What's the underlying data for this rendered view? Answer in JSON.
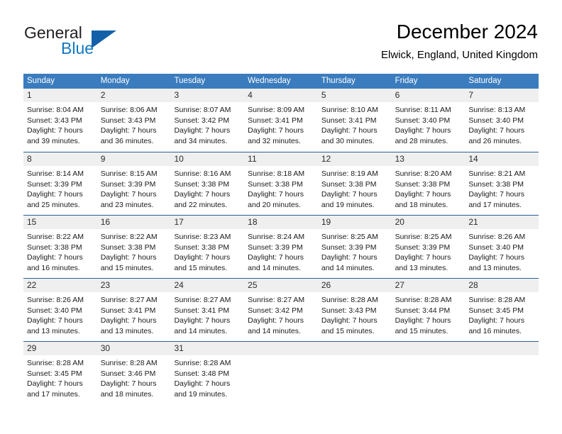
{
  "brand": {
    "name_part1": "General",
    "name_part2": "Blue",
    "triangle_icon": "triangle-icon",
    "accent_color": "#1460a8",
    "blue_text_color": "#1277c0"
  },
  "header": {
    "month_title": "December 2024",
    "location": "Elwick, England, United Kingdom"
  },
  "calendar": {
    "header_bg": "#3a7cbe",
    "daynum_bg": "#efefef",
    "row_divider": "#2a6099",
    "weekdays": [
      "Sunday",
      "Monday",
      "Tuesday",
      "Wednesday",
      "Thursday",
      "Friday",
      "Saturday"
    ],
    "weeks": [
      [
        {
          "day": "1",
          "sunrise": "Sunrise: 8:04 AM",
          "sunset": "Sunset: 3:43 PM",
          "daylight1": "Daylight: 7 hours",
          "daylight2": "and 39 minutes."
        },
        {
          "day": "2",
          "sunrise": "Sunrise: 8:06 AM",
          "sunset": "Sunset: 3:43 PM",
          "daylight1": "Daylight: 7 hours",
          "daylight2": "and 36 minutes."
        },
        {
          "day": "3",
          "sunrise": "Sunrise: 8:07 AM",
          "sunset": "Sunset: 3:42 PM",
          "daylight1": "Daylight: 7 hours",
          "daylight2": "and 34 minutes."
        },
        {
          "day": "4",
          "sunrise": "Sunrise: 8:09 AM",
          "sunset": "Sunset: 3:41 PM",
          "daylight1": "Daylight: 7 hours",
          "daylight2": "and 32 minutes."
        },
        {
          "day": "5",
          "sunrise": "Sunrise: 8:10 AM",
          "sunset": "Sunset: 3:41 PM",
          "daylight1": "Daylight: 7 hours",
          "daylight2": "and 30 minutes."
        },
        {
          "day": "6",
          "sunrise": "Sunrise: 8:11 AM",
          "sunset": "Sunset: 3:40 PM",
          "daylight1": "Daylight: 7 hours",
          "daylight2": "and 28 minutes."
        },
        {
          "day": "7",
          "sunrise": "Sunrise: 8:13 AM",
          "sunset": "Sunset: 3:40 PM",
          "daylight1": "Daylight: 7 hours",
          "daylight2": "and 26 minutes."
        }
      ],
      [
        {
          "day": "8",
          "sunrise": "Sunrise: 8:14 AM",
          "sunset": "Sunset: 3:39 PM",
          "daylight1": "Daylight: 7 hours",
          "daylight2": "and 25 minutes."
        },
        {
          "day": "9",
          "sunrise": "Sunrise: 8:15 AM",
          "sunset": "Sunset: 3:39 PM",
          "daylight1": "Daylight: 7 hours",
          "daylight2": "and 23 minutes."
        },
        {
          "day": "10",
          "sunrise": "Sunrise: 8:16 AM",
          "sunset": "Sunset: 3:38 PM",
          "daylight1": "Daylight: 7 hours",
          "daylight2": "and 22 minutes."
        },
        {
          "day": "11",
          "sunrise": "Sunrise: 8:18 AM",
          "sunset": "Sunset: 3:38 PM",
          "daylight1": "Daylight: 7 hours",
          "daylight2": "and 20 minutes."
        },
        {
          "day": "12",
          "sunrise": "Sunrise: 8:19 AM",
          "sunset": "Sunset: 3:38 PM",
          "daylight1": "Daylight: 7 hours",
          "daylight2": "and 19 minutes."
        },
        {
          "day": "13",
          "sunrise": "Sunrise: 8:20 AM",
          "sunset": "Sunset: 3:38 PM",
          "daylight1": "Daylight: 7 hours",
          "daylight2": "and 18 minutes."
        },
        {
          "day": "14",
          "sunrise": "Sunrise: 8:21 AM",
          "sunset": "Sunset: 3:38 PM",
          "daylight1": "Daylight: 7 hours",
          "daylight2": "and 17 minutes."
        }
      ],
      [
        {
          "day": "15",
          "sunrise": "Sunrise: 8:22 AM",
          "sunset": "Sunset: 3:38 PM",
          "daylight1": "Daylight: 7 hours",
          "daylight2": "and 16 minutes."
        },
        {
          "day": "16",
          "sunrise": "Sunrise: 8:22 AM",
          "sunset": "Sunset: 3:38 PM",
          "daylight1": "Daylight: 7 hours",
          "daylight2": "and 15 minutes."
        },
        {
          "day": "17",
          "sunrise": "Sunrise: 8:23 AM",
          "sunset": "Sunset: 3:38 PM",
          "daylight1": "Daylight: 7 hours",
          "daylight2": "and 15 minutes."
        },
        {
          "day": "18",
          "sunrise": "Sunrise: 8:24 AM",
          "sunset": "Sunset: 3:39 PM",
          "daylight1": "Daylight: 7 hours",
          "daylight2": "and 14 minutes."
        },
        {
          "day": "19",
          "sunrise": "Sunrise: 8:25 AM",
          "sunset": "Sunset: 3:39 PM",
          "daylight1": "Daylight: 7 hours",
          "daylight2": "and 14 minutes."
        },
        {
          "day": "20",
          "sunrise": "Sunrise: 8:25 AM",
          "sunset": "Sunset: 3:39 PM",
          "daylight1": "Daylight: 7 hours",
          "daylight2": "and 13 minutes."
        },
        {
          "day": "21",
          "sunrise": "Sunrise: 8:26 AM",
          "sunset": "Sunset: 3:40 PM",
          "daylight1": "Daylight: 7 hours",
          "daylight2": "and 13 minutes."
        }
      ],
      [
        {
          "day": "22",
          "sunrise": "Sunrise: 8:26 AM",
          "sunset": "Sunset: 3:40 PM",
          "daylight1": "Daylight: 7 hours",
          "daylight2": "and 13 minutes."
        },
        {
          "day": "23",
          "sunrise": "Sunrise: 8:27 AM",
          "sunset": "Sunset: 3:41 PM",
          "daylight1": "Daylight: 7 hours",
          "daylight2": "and 13 minutes."
        },
        {
          "day": "24",
          "sunrise": "Sunrise: 8:27 AM",
          "sunset": "Sunset: 3:41 PM",
          "daylight1": "Daylight: 7 hours",
          "daylight2": "and 14 minutes."
        },
        {
          "day": "25",
          "sunrise": "Sunrise: 8:27 AM",
          "sunset": "Sunset: 3:42 PM",
          "daylight1": "Daylight: 7 hours",
          "daylight2": "and 14 minutes."
        },
        {
          "day": "26",
          "sunrise": "Sunrise: 8:28 AM",
          "sunset": "Sunset: 3:43 PM",
          "daylight1": "Daylight: 7 hours",
          "daylight2": "and 15 minutes."
        },
        {
          "day": "27",
          "sunrise": "Sunrise: 8:28 AM",
          "sunset": "Sunset: 3:44 PM",
          "daylight1": "Daylight: 7 hours",
          "daylight2": "and 15 minutes."
        },
        {
          "day": "28",
          "sunrise": "Sunrise: 8:28 AM",
          "sunset": "Sunset: 3:45 PM",
          "daylight1": "Daylight: 7 hours",
          "daylight2": "and 16 minutes."
        }
      ],
      [
        {
          "day": "29",
          "sunrise": "Sunrise: 8:28 AM",
          "sunset": "Sunset: 3:45 PM",
          "daylight1": "Daylight: 7 hours",
          "daylight2": "and 17 minutes."
        },
        {
          "day": "30",
          "sunrise": "Sunrise: 8:28 AM",
          "sunset": "Sunset: 3:46 PM",
          "daylight1": "Daylight: 7 hours",
          "daylight2": "and 18 minutes."
        },
        {
          "day": "31",
          "sunrise": "Sunrise: 8:28 AM",
          "sunset": "Sunset: 3:48 PM",
          "daylight1": "Daylight: 7 hours",
          "daylight2": "and 19 minutes."
        },
        {
          "day": "",
          "sunrise": "",
          "sunset": "",
          "daylight1": "",
          "daylight2": ""
        },
        {
          "day": "",
          "sunrise": "",
          "sunset": "",
          "daylight1": "",
          "daylight2": ""
        },
        {
          "day": "",
          "sunrise": "",
          "sunset": "",
          "daylight1": "",
          "daylight2": ""
        },
        {
          "day": "",
          "sunrise": "",
          "sunset": "",
          "daylight1": "",
          "daylight2": ""
        }
      ]
    ]
  }
}
